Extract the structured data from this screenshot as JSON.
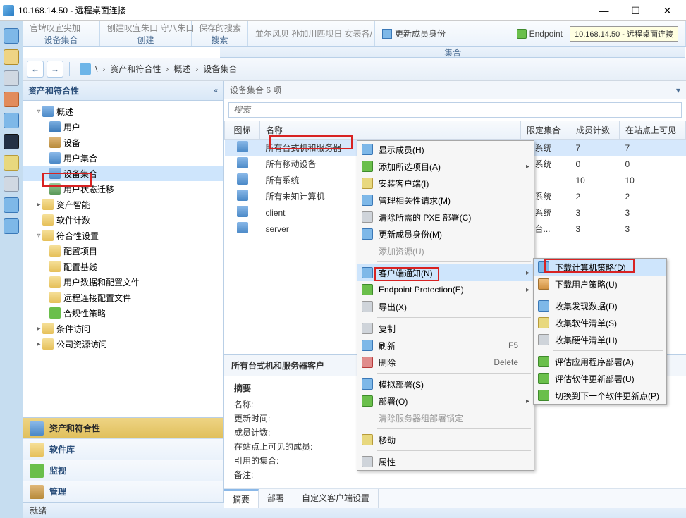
{
  "titlebar": {
    "text": "10.168.14.50 - 远程桌面连接"
  },
  "ribbon": {
    "g0": {
      "top": "官埤叹宜尖加",
      "bottom": "设备集合"
    },
    "g1": {
      "top": "刨建叹宜朱口 守八朱口",
      "bottom": "创建"
    },
    "g2": {
      "top": "保存的搜索",
      "bottom": "搜索"
    },
    "g3": {
      "top": "並尓风贝 孙加川匹坝日 女表各/",
      "bottom": ""
    },
    "g4": {
      "text": "更新成员身份",
      "bottom": "集合"
    },
    "ep": "Endpoint",
    "ipbox": "10.168.14.50 - 远程桌面连接"
  },
  "breadcrumb": {
    "root": "\\",
    "items": [
      "资产和符合性",
      "概述",
      "设备集合"
    ]
  },
  "sidebar": {
    "title": "资产和符合性",
    "tree": {
      "overview": "概述",
      "items": [
        "用户",
        "设备",
        "用户集合",
        "设备集合",
        "用户状态迁移",
        "资产智能",
        "软件计数",
        "符合性设置"
      ],
      "compliance_children": [
        "配置项目",
        "配置基线",
        "用户数据和配置文件",
        "远程连接配置文件",
        "合规性策略",
        "条件访问",
        "公司资源访问"
      ]
    },
    "nav": {
      "a": "资产和符合性",
      "b": "软件库",
      "c": "监视",
      "d": "管理"
    }
  },
  "content": {
    "title": "设备集合 6 项",
    "search_ph": "搜索",
    "columns": {
      "icon": "图标",
      "name": "名称",
      "limit": "限定集合",
      "count": "成员计数",
      "site": "在站点上可见"
    },
    "rows": [
      {
        "name": "所有台式机和服务器",
        "limit": "有系统",
        "count": "7",
        "site": "7"
      },
      {
        "name": "所有移动设备",
        "limit": "有系统",
        "count": "0",
        "site": "0"
      },
      {
        "name": "所有系统",
        "limit": "",
        "count": "10",
        "site": "10"
      },
      {
        "name": "所有未知计算机",
        "limit": "有系统",
        "count": "2",
        "site": "2"
      },
      {
        "name": "client",
        "limit": "有系统",
        "count": "3",
        "site": "3"
      },
      {
        "name": "server",
        "limit": "闻台...",
        "count": "3",
        "site": "3"
      }
    ]
  },
  "ctx1": {
    "show_members": "显示成员(H)",
    "add_sel": "添加所选项目(A)",
    "install_client": "安装客户端(I)",
    "manage_req": "管理相关性请求(M)",
    "clear_pxe": "清除所需的 PXE 部署(C)",
    "update_members": "更新成员身份(M)",
    "add_res": "添加资源(U)",
    "client_notif": "客户端通知(N)",
    "endpoint": "Endpoint Protection(E)",
    "export": "导出(X)",
    "copy": "复制",
    "refresh": "刷新",
    "refresh_sc": "F5",
    "delete": "删除",
    "delete_sc": "Delete",
    "sim_deploy": "模拟部署(S)",
    "deploy": "部署(O)",
    "clear_srv": "清除服务器组部署锁定",
    "move": "移动",
    "props": "属性"
  },
  "submenu": {
    "dl_comp": "下载计算机策略(D)",
    "dl_user": "下载用户策略(U)",
    "coll_disc": "收集发现数据(D)",
    "coll_sw": "收集软件清单(S)",
    "coll_hw": "收集硬件清单(H)",
    "eval_app": "评估应用程序部署(A)",
    "eval_sw": "评估软件更新部署(U)",
    "switch_pt": "切换到下一个软件更新点(P)"
  },
  "bottom": {
    "head": "所有台式机和服务器客户",
    "summary": "摘要",
    "fields": [
      "名称:",
      "更新时间:",
      "成员计数:",
      "在站点上可见的成员:",
      "引用的集合:",
      "备注:"
    ],
    "tabs": [
      "摘要",
      "部署",
      "自定义客户端设置"
    ]
  },
  "status": "就绪"
}
